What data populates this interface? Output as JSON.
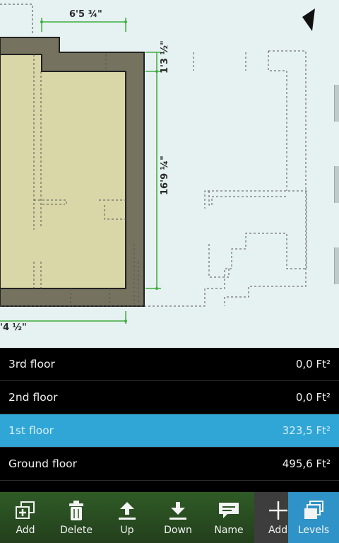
{
  "canvas": {
    "dimensions": {
      "top": "6'5 ¾\"",
      "right_short": "1'3 ½\"",
      "right_long": "16'9 ¼\"",
      "bottom": "'4 ½\""
    }
  },
  "levels": [
    {
      "name": "3rd floor",
      "area": "0,0 Ft²",
      "selected": false
    },
    {
      "name": "2nd floor",
      "area": "0,0 Ft²",
      "selected": false
    },
    {
      "name": "1st floor",
      "area": "323,5 Ft²",
      "selected": true
    },
    {
      "name": "Ground floor",
      "area": "495,6 Ft²",
      "selected": false
    }
  ],
  "toolbar": {
    "add_label": "Add",
    "delete_label": "Delete",
    "up_label": "Up",
    "down_label": "Down",
    "name_label": "Name",
    "add2_label": "Add",
    "levels_label": "Levels"
  },
  "icons": [
    "add-level-icon",
    "trash-icon",
    "move-up-icon",
    "move-down-icon",
    "rename-icon",
    "plus-icon",
    "layers-icon",
    "north-arrow-icon"
  ],
  "colors": {
    "canvas_bg": "#e6f1f1",
    "room_fill": "#d9d6a8",
    "wall_fill": "#7b7a68",
    "dimension_green": "#3fae3f",
    "toolbar_bg": "#2c5324",
    "selected_row": "#30a6d6",
    "levels_button": "#2f93c7"
  }
}
